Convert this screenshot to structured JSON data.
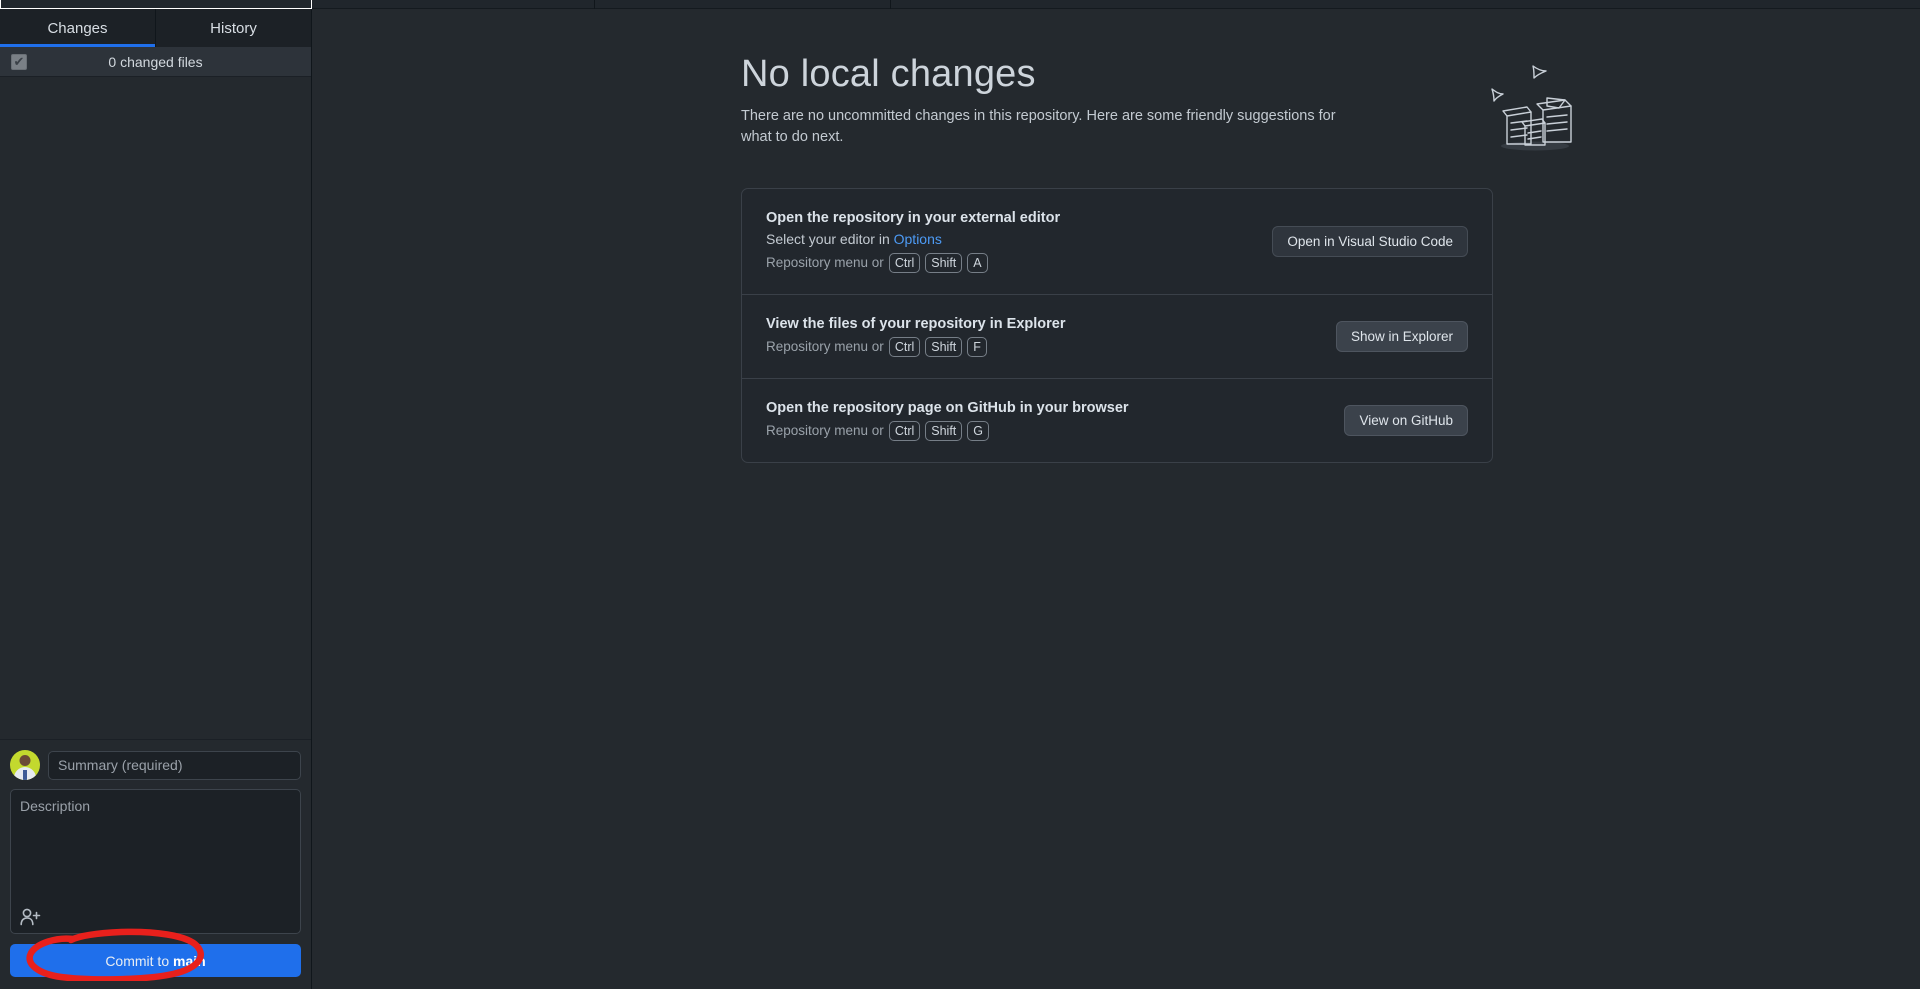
{
  "app": {
    "background": "#24292e",
    "accent": "#1f6feb",
    "link_color": "#4d9bf5"
  },
  "toolbar": {
    "segments": [
      "repository-section",
      "branch-section",
      "fetch-section",
      "spacer-section"
    ]
  },
  "sidebar": {
    "tabs": [
      {
        "label": "Changes",
        "active": true
      },
      {
        "label": "History",
        "active": false
      }
    ],
    "file_list": {
      "select_all_checked": true,
      "check_glyph": "✔",
      "summary": "0 changed files"
    },
    "commit": {
      "avatar_name": "user-avatar",
      "summary_placeholder": "Summary (required)",
      "summary_value": "",
      "description_placeholder": "Description",
      "description_value": "",
      "coauthor_icon": "add-person-icon",
      "button_prefix": "Commit to ",
      "button_branch": "main"
    }
  },
  "main": {
    "blank_slate": {
      "title": "No local changes",
      "subtitle": "There are no uncommitted changes in this repository. Here are some friendly suggestions for what to do next.",
      "art_name": "boxes-and-birds-illustration"
    },
    "suggestions": [
      {
        "name": "open-in-external-editor",
        "title": "Open the repository in your external editor",
        "subtitle_prefix": "Select your editor in ",
        "subtitle_link": "Options",
        "shortcut_prefix": "Repository menu or",
        "keys": [
          "Ctrl",
          "Shift",
          "A"
        ],
        "button_label": "Open in Visual Studio Code",
        "button_style": "dark"
      },
      {
        "name": "view-files-in-explorer",
        "title": "View the files of your repository in Explorer",
        "subtitle_prefix": "",
        "subtitle_link": "",
        "shortcut_prefix": "Repository menu or",
        "keys": [
          "Ctrl",
          "Shift",
          "F"
        ],
        "button_label": "Show in Explorer",
        "button_style": "light"
      },
      {
        "name": "view-on-github",
        "title": "Open the repository page on GitHub in your browser",
        "subtitle_prefix": "",
        "subtitle_link": "",
        "shortcut_prefix": "Repository menu or",
        "keys": [
          "Ctrl",
          "Shift",
          "G"
        ],
        "button_label": "View on GitHub",
        "button_style": "light"
      }
    ]
  },
  "annotation": {
    "name": "red-highlight-circle",
    "color": "#e8201c",
    "target": "commit-to-main-button"
  }
}
